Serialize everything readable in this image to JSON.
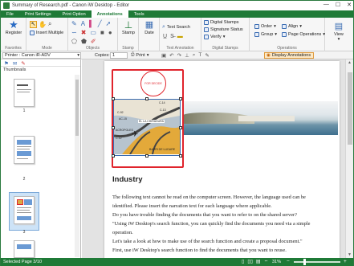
{
  "window": {
    "title": "Summary of Research.pdf - Canon iW Desktop - Editor"
  },
  "ribbon_tabs": [
    "File",
    "Print Settings",
    "Print Option",
    "Annotations",
    "Tools"
  ],
  "ribbon": {
    "register": "Register",
    "favorites_group": "Favorites",
    "insert_multiple": "Insert Multiple",
    "mode_group": "Mode",
    "objects_group": "Objects",
    "stamp": "Stamp",
    "stamp_group": "Stamp",
    "date": "Date",
    "text_annotation": "Text Annotation",
    "text_search": "Text Search",
    "signature_status": "Signature Status",
    "verify": "Verify",
    "digital_stamps": "Digital Stamps",
    "digital_stamps_group": "Digital Stamps",
    "order": "Order",
    "group": "Group",
    "align": "Align",
    "page_operations": "Page Operations",
    "operations_group": "Operations",
    "view": "View"
  },
  "toolbar": {
    "printer": "Printer : Canon iR-ADV",
    "copies_label": "Copies:",
    "copies_value": "1",
    "print": "Print",
    "display_annotations": "Display Annotations"
  },
  "thumbnails": {
    "label": "Thumbnails",
    "pages": [
      "1",
      "2",
      "3"
    ]
  },
  "document": {
    "stamp_text": "FOR DECIDE",
    "map_labels": [
      "C-14",
      "C-92",
      "C-13",
      "AC-15",
      "EL LA CHIRADURA",
      "C-12",
      "ACROPOLES",
      "BARRI DE LLIDARE"
    ],
    "heading": "Industry",
    "lines": [
      "The following text cannot be read on the computer screen. However, the language used can be",
      "identified. Please insert the narration text for each language where applicable.",
      "Do you have trouble finding the documents that you want to refer to on the shared server?",
      "\"Using iW Desktop's search function, you can quickly find the documents you need via a simple",
      "operation.",
      "Let's take a look at how to make use of the search function and create a proposal document.\"",
      "First, use iW Desktop's search function to find the documents that you want to reuse."
    ]
  },
  "status": {
    "selected_page": "Selected Page 3/10",
    "zoom": "31%"
  },
  "colors": {
    "brand_green": "#1f7a37",
    "annotation_red": "#e0242c",
    "selection_blue": "#cde3f7"
  }
}
